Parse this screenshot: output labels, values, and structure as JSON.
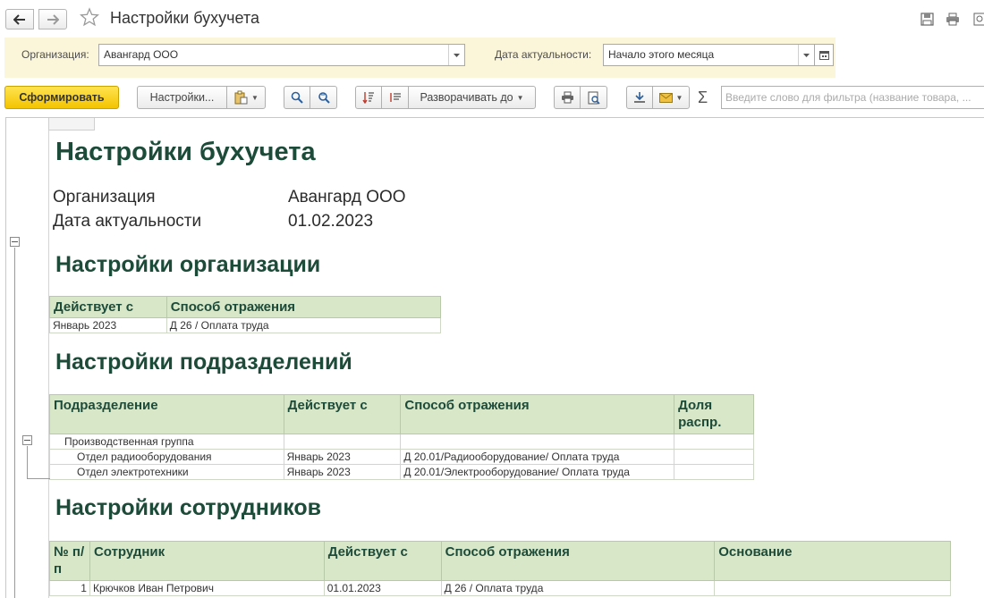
{
  "window": {
    "title": "Настройки бухучета"
  },
  "params": {
    "org_label": "Организация:",
    "org_value": "Авангард ООО",
    "date_label": "Дата актуальности:",
    "date_value": "Начало этого месяца"
  },
  "toolbar": {
    "generate_label": "Сформировать",
    "settings_label": "Настройки...",
    "expand_label": "Разворачивать до",
    "sigma": "Σ",
    "filter_placeholder": "Введите слово для фильтра (название товара, ..."
  },
  "report": {
    "title": "Настройки бухучета",
    "org_label": "Организация",
    "org_value": "Авангард ООО",
    "date_label": "Дата актуальности",
    "date_value": "01.02.2023",
    "section_org": {
      "title": "Настройки организации",
      "headers": [
        "Действует с",
        "Способ отражения"
      ],
      "rows": [
        [
          "Январь 2023",
          "Д 26 / Оплата труда"
        ]
      ]
    },
    "section_dept": {
      "title": "Настройки подразделений",
      "headers": [
        "Подразделение",
        "Действует с",
        "Способ отражения",
        "Доля распр."
      ],
      "group": "Производственная группа",
      "rows": [
        [
          "Отдел радиооборудования",
          "Январь 2023",
          "Д 20.01/Радиооборудование/ Оплата труда",
          ""
        ],
        [
          "Отдел электротехники",
          "Январь 2023",
          "Д 20.01/Электрооборудование/ Оплата труда",
          ""
        ]
      ]
    },
    "section_emp": {
      "title": "Настройки сотрудников",
      "headers": [
        "№ п/п",
        "Сотрудник",
        "Действует с",
        "Способ отражения",
        "Основание"
      ],
      "rows": [
        [
          "1",
          "Крючков Иван Петрович",
          "01.01.2023",
          "Д 26 / Оплата труда",
          ""
        ]
      ]
    }
  },
  "colors": {
    "accent_yellow": "#f3c400",
    "header_green": "#d8e7c8",
    "title_green": "#1d4b3a",
    "params_bg": "#fbf5d9"
  },
  "icons": [
    "arrow-left-icon",
    "arrow-right-icon",
    "star-icon",
    "save-icon",
    "print-icon",
    "link-icon",
    "search-icon",
    "refresh-search-icon",
    "sort-icon",
    "list-icon",
    "preview-icon",
    "download-icon",
    "mail-icon",
    "calendar-icon"
  ]
}
